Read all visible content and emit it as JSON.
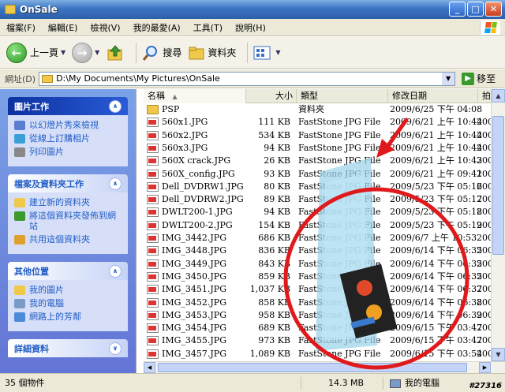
{
  "window": {
    "title": "OnSale",
    "min_glyph": "_",
    "max_glyph": "□",
    "close_glyph": "✕"
  },
  "menu": [
    "檔案(F)",
    "編輯(E)",
    "檢視(V)",
    "我的最愛(A)",
    "工具(T)",
    "說明(H)"
  ],
  "toolbar": {
    "back_label": "上一頁",
    "search_label": "搜尋",
    "folders_label": "資料夾"
  },
  "address": {
    "label": "網址(D)",
    "path": "D:\\My Documents\\My Pictures\\OnSale",
    "go_label": "移至"
  },
  "taskpane": {
    "picture_tasks": {
      "title": "圖片工作",
      "items": [
        "以幻燈片秀來檢視",
        "從線上訂購相片",
        "列印圖片"
      ]
    },
    "file_tasks": {
      "title": "檔案及資料夾工作",
      "items": [
        "建立新的資料夾",
        "將這個資料夾發佈到網站",
        "共用這個資料夾"
      ]
    },
    "other_places": {
      "title": "其他位置",
      "items": [
        "我的圖片",
        "我的電腦",
        "網路上的芳鄰"
      ]
    },
    "details": {
      "title": "詳細資料"
    }
  },
  "columns": {
    "name": "名稱",
    "size": "大小",
    "type": "類型",
    "date": "修改日期",
    "extra": "拍"
  },
  "files": [
    {
      "icon": "folder",
      "name": "PSP",
      "size": "",
      "type": "資料夾",
      "date": "2009/6/25 下午 04:08",
      "extra": ""
    },
    {
      "icon": "jpg",
      "name": "560x1.JPG",
      "size": "111 KB",
      "type": "FastStone JPG File",
      "date": "2009/6/21 上午 10:44",
      "extra": "200"
    },
    {
      "icon": "jpg",
      "name": "560x2.JPG",
      "size": "534 KB",
      "type": "FastStone JPG File",
      "date": "2009/6/21 上午 10:44",
      "extra": "200"
    },
    {
      "icon": "jpg",
      "name": "560x3.JPG",
      "size": "94 KB",
      "type": "FastStone JPG File",
      "date": "2009/6/21 上午 10:44",
      "extra": "200"
    },
    {
      "icon": "jpg",
      "name": "560X crack.JPG",
      "size": "26 KB",
      "type": "FastStone JPG File",
      "date": "2009/6/21 上午 10:43",
      "extra": "200"
    },
    {
      "icon": "jpg",
      "name": "560X_config.JPG",
      "size": "93 KB",
      "type": "FastStone JPG File",
      "date": "2009/6/21 上午 09:41",
      "extra": "200"
    },
    {
      "icon": "jpg",
      "name": "Dell_DVDRW1.JPG",
      "size": "80 KB",
      "type": "FastStone JPG File",
      "date": "2009/5/23 下午 05:16",
      "extra": "200"
    },
    {
      "icon": "jpg",
      "name": "Dell_DVDRW2.JPG",
      "size": "89 KB",
      "type": "FastStone JPG File",
      "date": "2009/5/23 下午 05:17",
      "extra": "200"
    },
    {
      "icon": "jpg",
      "name": "DWLT200-1.JPG",
      "size": "94 KB",
      "type": "FastStone JPG File",
      "date": "2009/5/23 下午 05:18",
      "extra": "200"
    },
    {
      "icon": "jpg",
      "name": "DWLT200-2.JPG",
      "size": "154 KB",
      "type": "FastStone JPG File",
      "date": "2009/5/23 下午 05:19",
      "extra": "200"
    },
    {
      "icon": "jpg",
      "name": "IMG_3442.JPG",
      "size": "686 KB",
      "type": "FastStone JPG File",
      "date": "2009/6/7 上午 10:53",
      "extra": "200"
    },
    {
      "icon": "jpg",
      "name": "IMG_3448.JPG",
      "size": "836 KB",
      "type": "FastStone JPG File",
      "date": "2009/6/14 下午 06:35",
      "extra": "200"
    },
    {
      "icon": "jpg",
      "name": "IMG_3449.JPG",
      "size": "843 KB",
      "type": "FastStone JPG File",
      "date": "2009/6/14 下午 06:35",
      "extra": "200"
    },
    {
      "icon": "jpg",
      "name": "IMG_3450.JPG",
      "size": "859 KB",
      "type": "FastStone JPG File",
      "date": "2009/6/14 下午 06:35",
      "extra": "200"
    },
    {
      "icon": "jpg",
      "name": "IMG_3451.JPG",
      "size": "1,037 KB",
      "type": "FastStone JPG File",
      "date": "2009/6/14 下午 06:37",
      "extra": "200"
    },
    {
      "icon": "jpg",
      "name": "IMG_3452.JPG",
      "size": "858 KB",
      "type": "FastStone JPG File",
      "date": "2009/6/14 下午 06:38",
      "extra": "200"
    },
    {
      "icon": "jpg",
      "name": "IMG_3453.JPG",
      "size": "958 KB",
      "type": "FastStone JPG File",
      "date": "2009/6/14 下午 06:39",
      "extra": "200"
    },
    {
      "icon": "jpg",
      "name": "IMG_3454.JPG",
      "size": "689 KB",
      "type": "FastStone JPG File",
      "date": "2009/6/15 下午 03:47",
      "extra": "200"
    },
    {
      "icon": "jpg",
      "name": "IMG_3455.JPG",
      "size": "973 KB",
      "type": "FastStone JPG File",
      "date": "2009/6/15 下午 03:47",
      "extra": "200"
    },
    {
      "icon": "jpg",
      "name": "IMG_3457.JPG",
      "size": "1,089 KB",
      "type": "FastStone JPG File",
      "date": "2009/6/15 下午 03:54",
      "extra": "200"
    }
  ],
  "status": {
    "count": "35 個物件",
    "size": "14.3 MB",
    "location": "我的電腦"
  },
  "watermark": "#27316",
  "colors": {
    "title_bar": "#2d5fa8",
    "taskpane": "#6375d6",
    "annotation": "#e0191c"
  }
}
